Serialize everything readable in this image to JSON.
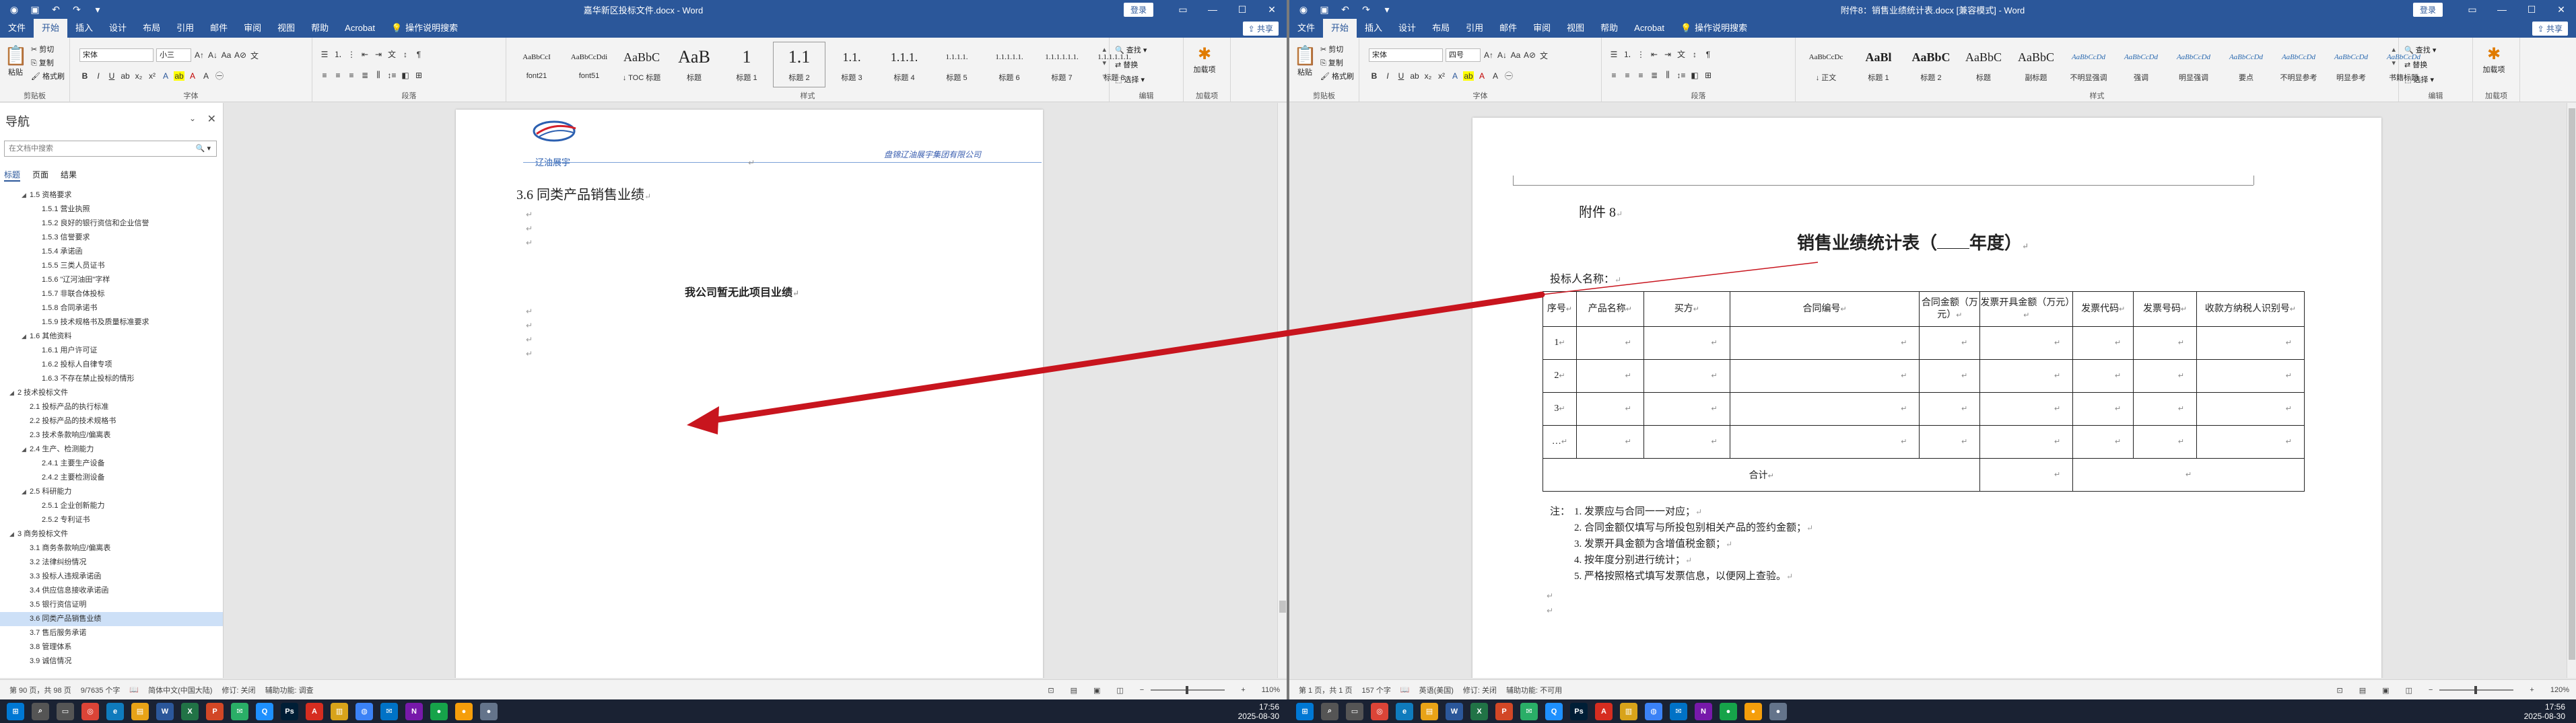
{
  "left": {
    "title": "嘉华新区投标文件.docx - Word",
    "signin": "登录",
    "tabs": [
      "文件",
      "开始",
      "插入",
      "设计",
      "布局",
      "引用",
      "邮件",
      "审阅",
      "视图",
      "帮助",
      "Acrobat"
    ],
    "tell_me": "操作说明搜索",
    "share": "共享",
    "clipboard": {
      "paste": "粘贴",
      "cut": "剪切",
      "copy": "复制",
      "format_painter": "格式刷",
      "group": "剪贴板"
    },
    "font": {
      "name": "宋体",
      "size": "小三",
      "group": "字体"
    },
    "paragraph_group": "段落",
    "styles_group": "样式",
    "styles": [
      {
        "sample": "AaBbCcI",
        "name": "font21"
      },
      {
        "sample": "AaBbCcDdi",
        "name": "font51"
      },
      {
        "sample": "AaBbC",
        "name": "↓ TOC 标题"
      },
      {
        "sample": "AaB",
        "name": "标题"
      },
      {
        "sample": "1",
        "name": "标题 1"
      },
      {
        "sample": "1.1",
        "name": "标题 2"
      },
      {
        "sample": "1.1.",
        "name": "标题 3"
      },
      {
        "sample": "1.1.1.",
        "name": "标题 4"
      },
      {
        "sample": "1.1.1.1.",
        "name": "标题 5"
      },
      {
        "sample": "1.1.1.1.1.",
        "name": "标题 6"
      },
      {
        "sample": "1.1.1.1.1.1.",
        "name": "标题 7"
      },
      {
        "sample": "1.1.1.1.1.1.",
        "name": "标题 8"
      }
    ],
    "editing": {
      "find": "查找",
      "replace": "替换",
      "select": "选择",
      "group": "编辑"
    },
    "addin": {
      "label": "加载项",
      "group": "加载项"
    },
    "nav": {
      "title": "导航",
      "search_placeholder": "在文档中搜索",
      "tabs": [
        "标题",
        "页面",
        "结果"
      ],
      "items": [
        {
          "t": "1.5 资格要求",
          "lvl": 1,
          "tri": "◢"
        },
        {
          "t": "1.5.1 营业执照",
          "lvl": 2
        },
        {
          "t": "1.5.2 良好的银行资信和企业信誉",
          "lvl": 2
        },
        {
          "t": "1.5.3 信誉要求",
          "lvl": 2
        },
        {
          "t": "1.5.4 承诺函",
          "lvl": 2
        },
        {
          "t": "1.5.5 三类人员证书",
          "lvl": 2
        },
        {
          "t": "1.5.6 \"辽河油田\"字样",
          "lvl": 2
        },
        {
          "t": "1.5.7 非联合体投标",
          "lvl": 2
        },
        {
          "t": "1.5.8 合同承诺书",
          "lvl": 2
        },
        {
          "t": "1.5.9 技术规格书及质量标准要求",
          "lvl": 2
        },
        {
          "t": "1.6 其他资料",
          "lvl": 1,
          "tri": "◢"
        },
        {
          "t": "1.6.1 用户许可证",
          "lvl": 2
        },
        {
          "t": "1.6.2 投标人自律专项",
          "lvl": 2
        },
        {
          "t": "1.6.3 不存在禁止投标的情形",
          "lvl": 2
        },
        {
          "t": "2 技术投标文件",
          "lvl": 0,
          "tri": "◢"
        },
        {
          "t": "2.1 投标产品的执行标准",
          "lvl": 1
        },
        {
          "t": "2.2 投标产品的技术规格书",
          "lvl": 1
        },
        {
          "t": "2.3 技术条款响应/偏离表",
          "lvl": 1
        },
        {
          "t": "2.4 生产、检测能力",
          "lvl": 1,
          "tri": "◢"
        },
        {
          "t": "2.4.1 主要生产设备",
          "lvl": 2
        },
        {
          "t": "2.4.2 主要检测设备",
          "lvl": 2
        },
        {
          "t": "2.5 科研能力",
          "lvl": 1,
          "tri": "◢"
        },
        {
          "t": "2.5.1 企业创新能力",
          "lvl": 2
        },
        {
          "t": "2.5.2 专利证书",
          "lvl": 2
        },
        {
          "t": "3 商务投标文件",
          "lvl": 0,
          "tri": "◢"
        },
        {
          "t": "3.1 商务条款响应/偏离表",
          "lvl": 1
        },
        {
          "t": "3.2 法律纠纷情况",
          "lvl": 1
        },
        {
          "t": "3.3 投标人违规承诺函",
          "lvl": 1
        },
        {
          "t": "3.4 供应信息接收承诺函",
          "lvl": 1
        },
        {
          "t": "3.5 银行资信证明",
          "lvl": 1
        },
        {
          "t": "3.6 同类产品销售业绩",
          "lvl": 1,
          "sel": true
        },
        {
          "t": "3.7 售后服务承诺",
          "lvl": 1
        },
        {
          "t": "3.8 管理体系",
          "lvl": 1
        },
        {
          "t": "3.9 诚信情况",
          "lvl": 1
        }
      ]
    },
    "page": {
      "logo_text": "辽油展宇",
      "header_company": "盘锦辽油展宇集团有限公司",
      "heading": "3.6    同类产品销售业绩",
      "body": "我公司暂无此项目业绩"
    },
    "status": {
      "page": "第 90 页，共 98 页",
      "words": "9/7635 个字",
      "lang": "简体中文(中国大陆)",
      "track": "修订: 关闭",
      "access": "辅助功能: 调查",
      "zoom": "110%"
    }
  },
  "right": {
    "title": "附件8：销售业绩统计表.docx [兼容模式] - Word",
    "signin": "登录",
    "tabs": [
      "文件",
      "开始",
      "插入",
      "设计",
      "布局",
      "引用",
      "邮件",
      "审阅",
      "视图",
      "帮助",
      "Acrobat"
    ],
    "tell_me": "操作说明搜索",
    "share": "共享",
    "clipboard": {
      "paste": "粘贴",
      "cut": "剪切",
      "copy": "复制",
      "format_painter": "格式刷",
      "group": "剪贴板"
    },
    "font": {
      "name": "宋体",
      "size": "四号",
      "group": "字体"
    },
    "paragraph_group": "段落",
    "styles_group": "样式",
    "styles": [
      {
        "sample": "AaBbCcDc",
        "name": "↓ 正文"
      },
      {
        "sample": "AaBl",
        "name": "标题 1"
      },
      {
        "sample": "AaBbC",
        "name": "标题 2"
      },
      {
        "sample": "AaBbC",
        "name": "标题"
      },
      {
        "sample": "AaBbC",
        "name": "副标题"
      },
      {
        "sample": "AaBbCcDd",
        "name": "不明显强调"
      },
      {
        "sample": "AaBbCcDd",
        "name": "强调"
      },
      {
        "sample": "AaBbCcDd",
        "name": "明显强调"
      },
      {
        "sample": "AaBbCcDd",
        "name": "要点"
      },
      {
        "sample": "AaBbCcDd",
        "name": "不明显参考"
      },
      {
        "sample": "AaBbCcDd",
        "name": "明显参考"
      },
      {
        "sample": "AaBbCcDd",
        "name": "书籍标题"
      }
    ],
    "editing": {
      "find": "查找",
      "replace": "替换",
      "select": "选择",
      "group": "编辑"
    },
    "addin": {
      "label": "加载项",
      "group": "加载项"
    },
    "doc": {
      "attachment": "附件 8",
      "title_prefix": "销售业绩统计表（",
      "title_year": "年度）",
      "bidder": "投标人名称：",
      "headers": [
        "序号",
        "产品名称",
        "买方",
        "合同编号",
        "合同金额（万元）",
        "发票开具金额（万元）",
        "发票代码",
        "发票号码",
        "收款方纳税人识别号"
      ],
      "rows": [
        "1",
        "2",
        "3",
        "…"
      ],
      "total": "合计",
      "notes_label": "注：",
      "notes": [
        "1. 发票应与合同一一对应；",
        "2. 合同金额仅填写与所投包别相关产品的签约金额；",
        "3. 发票开具金额为含增值税金额；",
        "4. 按年度分别进行统计；",
        "5. 严格按照格式填写发票信息，以便网上查验。"
      ]
    },
    "status": {
      "page": "第 1 页，共 1 页",
      "words": "157 个字",
      "lang": "英语(美国)",
      "track": "修订: 关闭",
      "access": "辅助功能: 不可用",
      "zoom": "120%"
    }
  },
  "taskbar": {
    "left_time": "17:56",
    "left_date": "2025-08-30",
    "right_time": "17:56",
    "right_date": "2025-08-30"
  },
  "colors": {
    "word_blue": "#2b579a",
    "arrow": "#c8151e"
  }
}
